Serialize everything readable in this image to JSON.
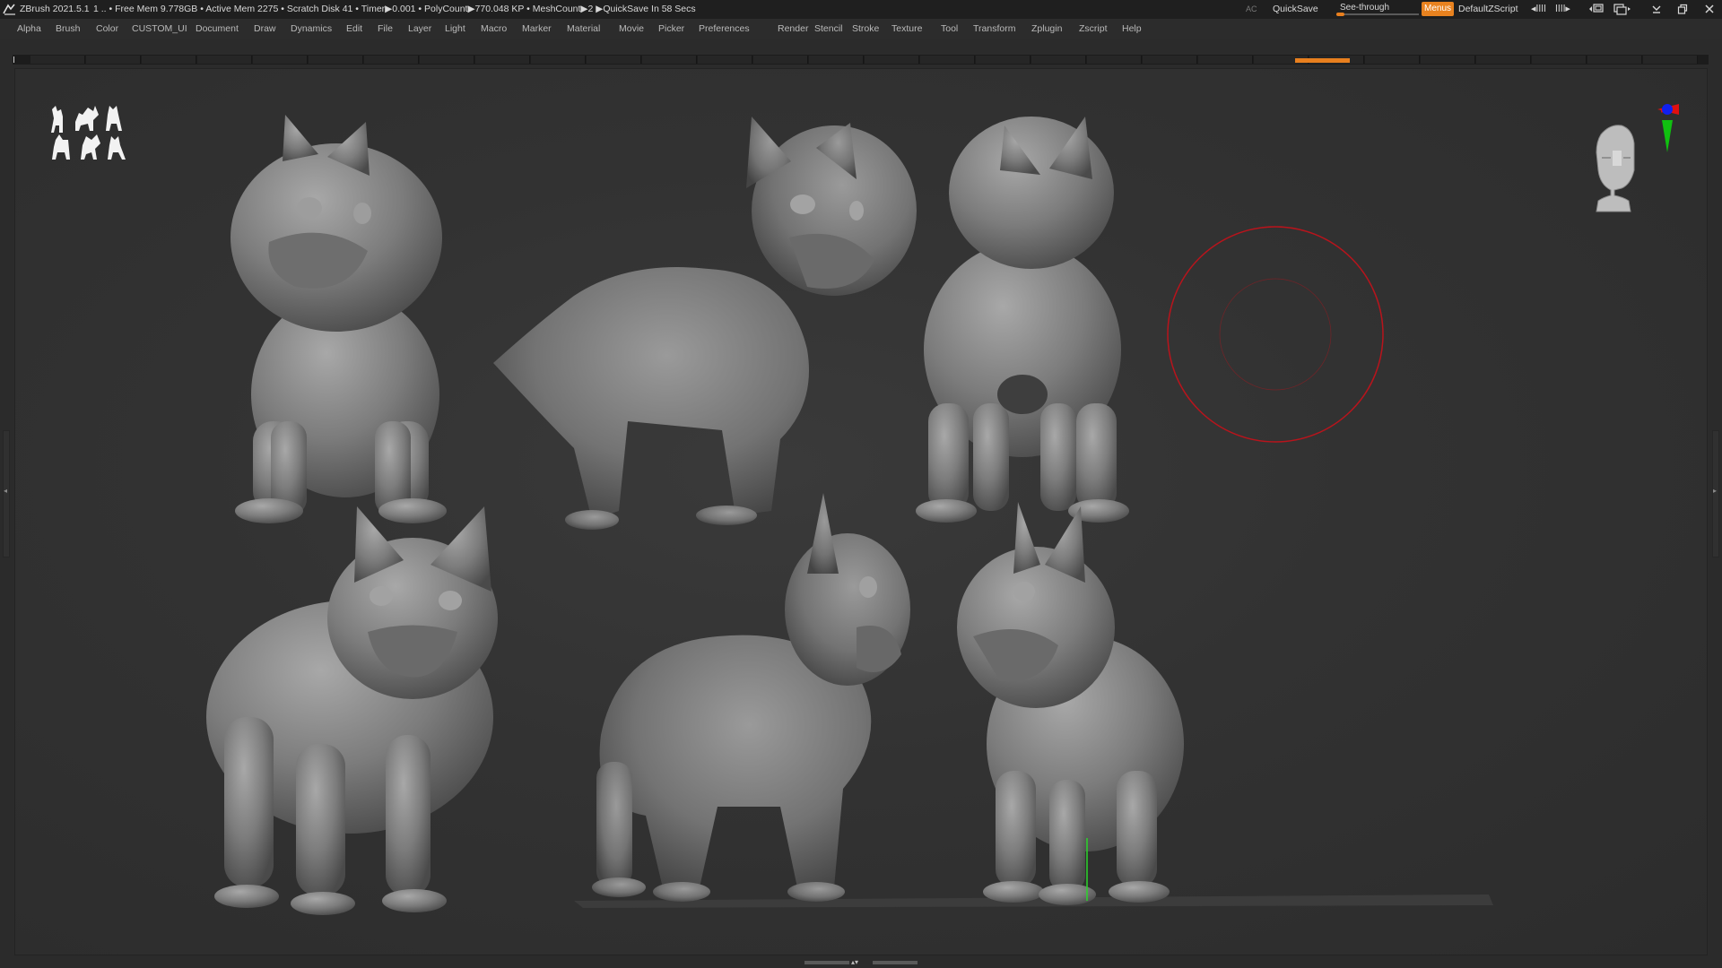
{
  "titlebar": {
    "app_title": "ZBrush 2021.5.1",
    "status": "1    .. • Free Mem 9.778GB • Active Mem 2275 • Scratch Disk 41 •  Timer▶0.001  • PolyCount▶770.048 KP  • MeshCount▶2  ▶QuickSave In 58 Secs",
    "ac_label": "AC",
    "quicksave_label": "QuickSave",
    "seethrough_label": "See-through",
    "seethrough_value": 0.1,
    "menus_label": "Menus",
    "script_name": "DefaultZScript",
    "icons": [
      "shrink-left-icon",
      "shrink-right-icon",
      "layout-switch-icon",
      "layout-swap-icon",
      "minimize-icon",
      "restore-icon",
      "close-icon"
    ]
  },
  "menubar": {
    "items": [
      "Alpha",
      "Brush",
      "Color",
      "CUSTOM_UI",
      "Document",
      "Draw",
      "Dynamics",
      "Edit",
      "File",
      "Layer",
      "Light",
      "Macro",
      "Marker",
      "Material",
      "Movie",
      "Picker",
      "Preferences",
      "Render",
      "Stencil",
      "Stroke",
      "Texture",
      "Tool",
      "Transform",
      "Zplugin",
      "Zscript",
      "Help"
    ]
  },
  "colors": {
    "accent": "#e87f1e",
    "background": "#2b2b2b",
    "canvas": "#333333",
    "brush_cursor": "#b8141c",
    "axis_x": "#e01010",
    "axis_y": "#10c010",
    "axis_z": "#1020f0",
    "sculpt": "#8a8a8a"
  },
  "canvas": {
    "logo_icon": "dog-silhouettes-logo-icon",
    "navigation_icon": "head-navigation-icon",
    "gizmo_icon": "axis-gizmo-icon",
    "brush_cursor_icon": "brush-cursor-icon",
    "models": [
      "dog-front-view",
      "dog-three-quarter-view",
      "dog-back-view",
      "dog-front-low-view",
      "dog-rear-three-quarter-view",
      "dog-side-three-quarter-view"
    ]
  }
}
